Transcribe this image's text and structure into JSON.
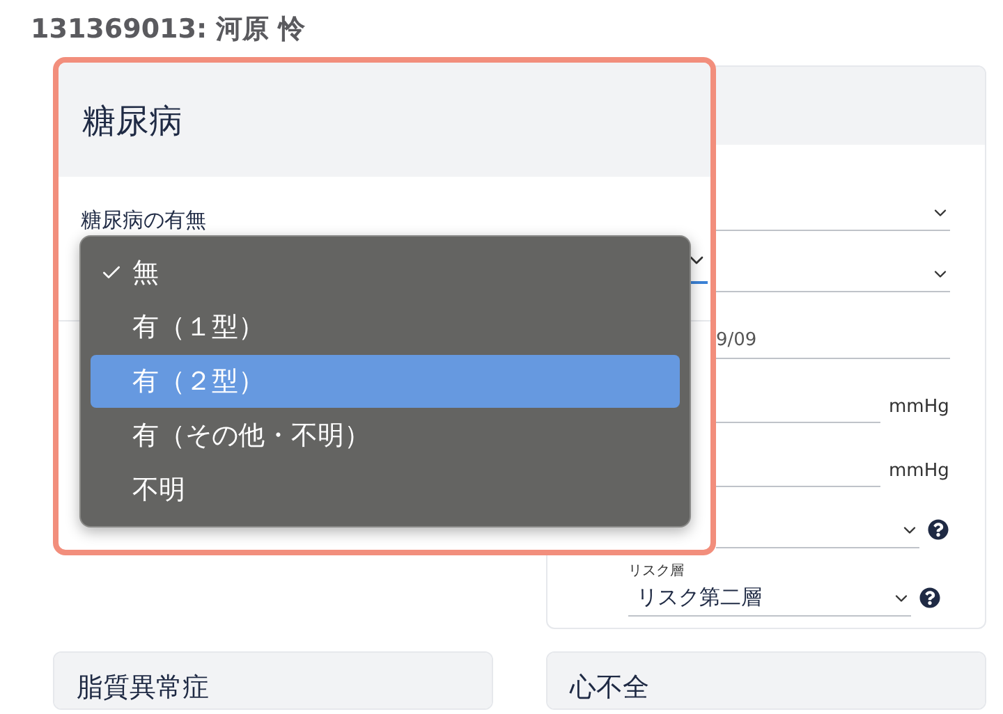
{
  "page_title": "131369013: 河原 怜",
  "focused_card": {
    "title": "糖尿病",
    "field_label": "糖尿病の有無",
    "menu": [
      {
        "label": "無",
        "checked": true,
        "selected": false
      },
      {
        "label": "有（１型）",
        "checked": false,
        "selected": false
      },
      {
        "label": "有（２型）",
        "checked": false,
        "selected": true
      },
      {
        "label": "有（その他・不明）",
        "checked": false,
        "selected": false
      },
      {
        "label": "不明",
        "checked": false,
        "selected": false
      }
    ]
  },
  "right_card": {
    "fields": [
      {
        "kind": "select"
      },
      {
        "kind": "select"
      },
      {
        "kind": "text",
        "value": "9/09"
      },
      {
        "kind": "unit",
        "unit": "mmHg"
      },
      {
        "kind": "unit",
        "unit": "mmHg"
      },
      {
        "kind": "help-select"
      },
      {
        "kind": "help-select",
        "label": "リスク層",
        "value": "リスク第二層"
      }
    ]
  },
  "bottom_cards": [
    {
      "title": "脂質異常症"
    },
    {
      "title": "心不全"
    }
  ]
}
